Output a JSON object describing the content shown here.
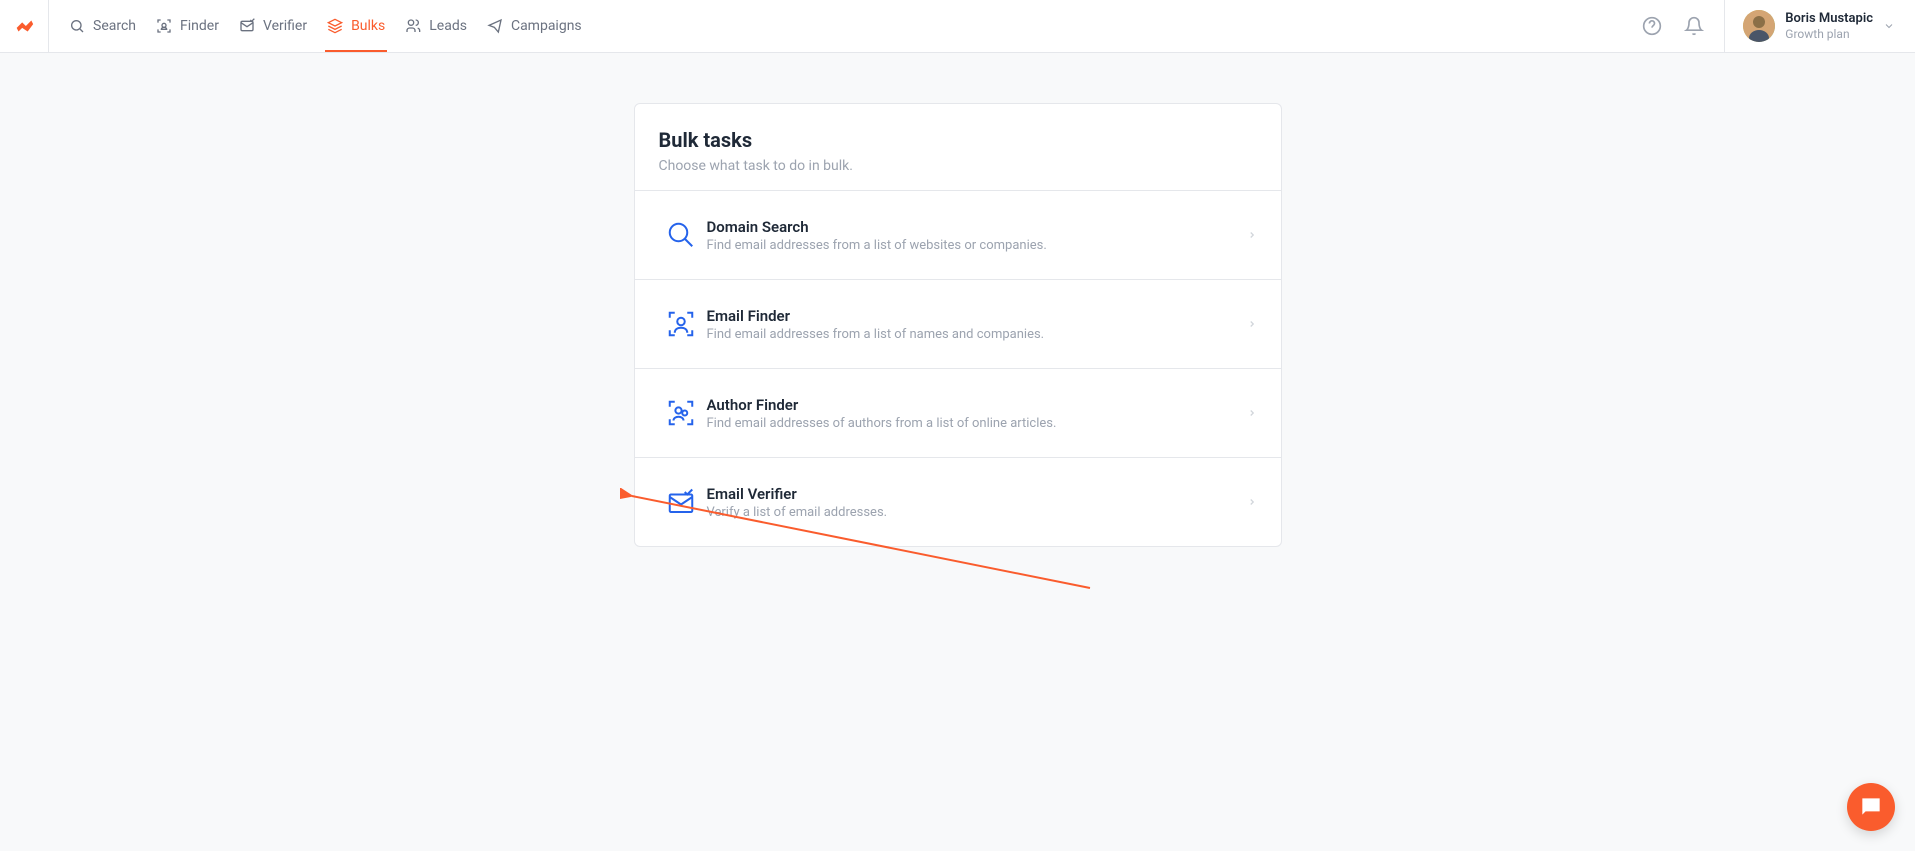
{
  "nav": {
    "items": [
      {
        "label": "Search"
      },
      {
        "label": "Finder"
      },
      {
        "label": "Verifier"
      },
      {
        "label": "Bulks"
      },
      {
        "label": "Leads"
      },
      {
        "label": "Campaigns"
      }
    ]
  },
  "user": {
    "name": "Boris Mustapic",
    "plan": "Growth plan"
  },
  "page": {
    "title": "Bulk tasks",
    "subtitle": "Choose what task to do in bulk."
  },
  "tasks": [
    {
      "title": "Domain Search",
      "desc": "Find email addresses from a list of websites or companies."
    },
    {
      "title": "Email Finder",
      "desc": "Find email addresses from a list of names and companies."
    },
    {
      "title": "Author Finder",
      "desc": "Find email addresses of authors from a list of online articles."
    },
    {
      "title": "Email Verifier",
      "desc": "Verify a list of email addresses."
    }
  ],
  "colors": {
    "accent": "#fa5c2d",
    "iconBlue": "#2563eb"
  }
}
